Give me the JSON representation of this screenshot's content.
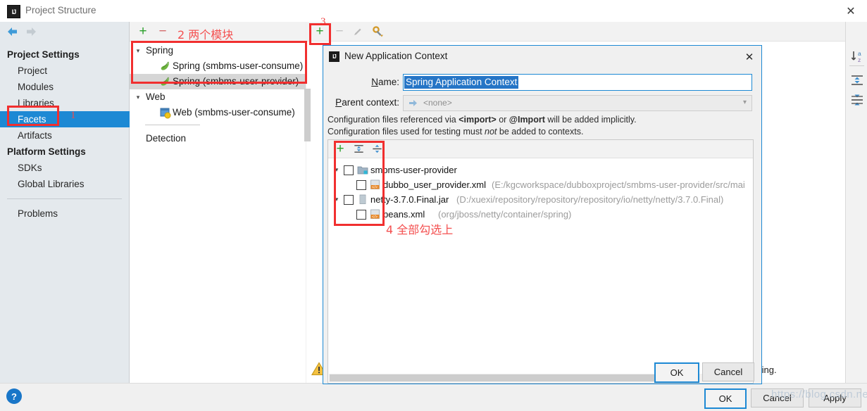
{
  "window": {
    "title": "Project Structure",
    "app_icon": "intellij-idea-icon",
    "close_label": "✕"
  },
  "sidebar": {
    "nav": {
      "back": "back-arrow-icon",
      "forward": "forward-arrow-icon"
    },
    "groups": [
      {
        "header": "Project Settings",
        "items": [
          {
            "label": "Project",
            "selected": false
          },
          {
            "label": "Modules",
            "selected": false
          },
          {
            "label": "Libraries",
            "selected": false
          },
          {
            "label": "Facets",
            "selected": true
          },
          {
            "label": "Artifacts",
            "selected": false
          }
        ]
      },
      {
        "header": "Platform Settings",
        "items": [
          {
            "label": "SDKs",
            "selected": false
          },
          {
            "label": "Global Libraries",
            "selected": false
          }
        ]
      }
    ],
    "problems": "Problems"
  },
  "facets_panel": {
    "toolbar": {
      "add": "+",
      "remove": "−"
    },
    "tree": [
      {
        "label": "Spring",
        "type": "group",
        "expanded": true,
        "indent": 0,
        "icon": "none"
      },
      {
        "label": "Spring (smbms-user-consume)",
        "type": "facet",
        "indent": 1,
        "icon": "spring-leaf-icon",
        "selected": false
      },
      {
        "label": "Spring (smbms-user-provider)",
        "type": "facet",
        "indent": 1,
        "icon": "spring-leaf-icon",
        "selected": true
      },
      {
        "label": "Web",
        "type": "group",
        "expanded": true,
        "indent": 0,
        "icon": "none"
      },
      {
        "label": "Web (smbms-user-consume)",
        "type": "facet",
        "indent": 1,
        "icon": "web-facet-icon",
        "selected": false
      }
    ],
    "detection": "Detection"
  },
  "detail_toolbar": {
    "add": "+",
    "remove": "−",
    "edit": "pencil-icon",
    "settings": "wrench-icon"
  },
  "right_strip": {
    "buttons": [
      {
        "name": "sort-alphabetically-icon",
        "label": "a↓z"
      },
      {
        "name": "expand-all-icon",
        "label": "expand"
      },
      {
        "name": "collapse-all-icon",
        "label": "collapse"
      }
    ]
  },
  "content": {
    "warning_icon": "warning-triangle-icon",
    "truncated_text": "ting."
  },
  "dialog": {
    "icon": "intellij-idea-icon",
    "title": "New Application Context",
    "close_label": "✕",
    "fields": {
      "name_label": "Name:",
      "name_mnemonic": "N",
      "name_value": "Spring Application Context",
      "parent_label": "Parent context:",
      "parent_mnemonic": "P",
      "parent_value": "<none>",
      "parent_arrow_icon": "arrow-right-icon",
      "parent_chevron_icon": "chevron-down-icon"
    },
    "notes": [
      {
        "parts": [
          {
            "t": "Configuration files referenced via ",
            "style": "normal"
          },
          {
            "t": "<import>",
            "style": "bold"
          },
          {
            "t": " or ",
            "style": "normal"
          },
          {
            "t": "@Import",
            "style": "bold"
          },
          {
            "t": " will be added implicitly.",
            "style": "normal"
          }
        ]
      },
      {
        "parts": [
          {
            "t": "Configuration files used for testing must ",
            "style": "normal"
          },
          {
            "t": "not",
            "style": "italic"
          },
          {
            "t": " be added to contexts.",
            "style": "normal"
          }
        ]
      }
    ],
    "list_toolbar": {
      "add": "+",
      "expand_all": "expand-all-icon",
      "collapse_all": "collapse-all-icon"
    },
    "list_rows": [
      {
        "indent": 0,
        "twisty": true,
        "checked": false,
        "icon": "module-folder-icon",
        "name": "smbms-user-provider",
        "path": ""
      },
      {
        "indent": 1,
        "twisty": false,
        "checked": false,
        "icon": "spring-xml-icon",
        "name": "dubbo_user_provider.xml",
        "path": "(E:/kgcworkspace/dubboxproject/smbms-user-provider/src/mai"
      },
      {
        "indent": 0,
        "twisty": true,
        "checked": false,
        "icon": "jar-icon",
        "name": "netty-3.7.0.Final.jar",
        "path": "(D:/xuexi/repository/repository/repository/io/netty/netty/3.7.0.Final)"
      },
      {
        "indent": 1,
        "twisty": false,
        "checked": false,
        "icon": "spring-xml-icon",
        "name": "beans.xml",
        "path": "(org/jboss/netty/container/spring)"
      }
    ],
    "buttons": {
      "ok": "OK",
      "cancel": "Cancel"
    }
  },
  "footer": {
    "help": "?",
    "ok": "OK",
    "cancel": "Cancel",
    "apply": "Apply"
  },
  "annotations": [
    {
      "id": "anno-1",
      "text": "1"
    },
    {
      "id": "anno-2",
      "text": "2  两个模块"
    },
    {
      "id": "anno-3",
      "text": "3"
    },
    {
      "id": "anno-4",
      "text": "4  全部勾选上"
    }
  ],
  "watermark": "https://blog.csdn.net/gaoxv_yan",
  "colors": {
    "accent": "#1d89d4",
    "selection": "#2575c6",
    "annotation": "#f12f2f",
    "sidebar_bg": "#e4e9ed"
  }
}
